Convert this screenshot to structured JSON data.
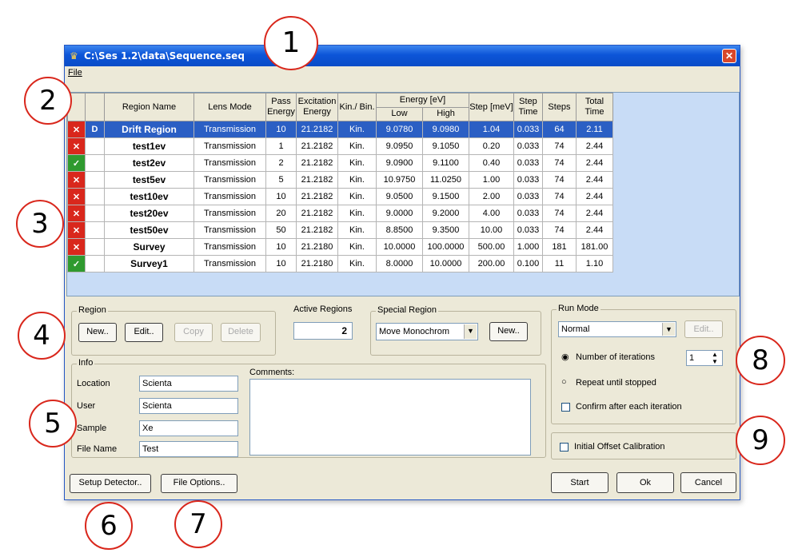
{
  "window": {
    "title": "C:\\Ses 1.2\\data\\Sequence.seq",
    "close_glyph": "✕"
  },
  "menu": {
    "file": "File"
  },
  "table": {
    "headers": {
      "region_name": "Region Name",
      "lens_mode": "Lens Mode",
      "pass_energy": "Pass Energy",
      "excitation_energy": "Excitation Energy",
      "kin_bin": "Kin./ Bin.",
      "energy_group": "Energy [eV]",
      "low": "Low",
      "high": "High",
      "step": "Step [meV]",
      "step_time": "Step Time",
      "steps": "Steps",
      "total_time": "Total Time"
    },
    "rows": [
      {
        "status": "x",
        "flag": "D",
        "name": "Drift Region",
        "lens": "Transmission",
        "pass": "10",
        "exc": "21.2182",
        "kin": "Kin.",
        "low": "9.0780",
        "high": "9.0980",
        "step": "1.04",
        "step_time": "0.033",
        "steps": "64",
        "total": "2.11",
        "selected": true
      },
      {
        "status": "x",
        "flag": "",
        "name": "test1ev",
        "lens": "Transmission",
        "pass": "1",
        "exc": "21.2182",
        "kin": "Kin.",
        "low": "9.0950",
        "high": "9.1050",
        "step": "0.20",
        "step_time": "0.033",
        "steps": "74",
        "total": "2.44"
      },
      {
        "status": "ok",
        "flag": "",
        "name": "test2ev",
        "lens": "Transmission",
        "pass": "2",
        "exc": "21.2182",
        "kin": "Kin.",
        "low": "9.0900",
        "high": "9.1100",
        "step": "0.40",
        "step_time": "0.033",
        "steps": "74",
        "total": "2.44"
      },
      {
        "status": "x",
        "flag": "",
        "name": "test5ev",
        "lens": "Transmission",
        "pass": "5",
        "exc": "21.2182",
        "kin": "Kin.",
        "low": "10.9750",
        "high": "11.0250",
        "step": "1.00",
        "step_time": "0.033",
        "steps": "74",
        "total": "2.44"
      },
      {
        "status": "x",
        "flag": "",
        "name": "test10ev",
        "lens": "Transmission",
        "pass": "10",
        "exc": "21.2182",
        "kin": "Kin.",
        "low": "9.0500",
        "high": "9.1500",
        "step": "2.00",
        "step_time": "0.033",
        "steps": "74",
        "total": "2.44"
      },
      {
        "status": "x",
        "flag": "",
        "name": "test20ev",
        "lens": "Transmission",
        "pass": "20",
        "exc": "21.2182",
        "kin": "Kin.",
        "low": "9.0000",
        "high": "9.2000",
        "step": "4.00",
        "step_time": "0.033",
        "steps": "74",
        "total": "2.44"
      },
      {
        "status": "x",
        "flag": "",
        "name": "test50ev",
        "lens": "Transmission",
        "pass": "50",
        "exc": "21.2182",
        "kin": "Kin.",
        "low": "8.8500",
        "high": "9.3500",
        "step": "10.00",
        "step_time": "0.033",
        "steps": "74",
        "total": "2.44"
      },
      {
        "status": "x",
        "flag": "",
        "name": "Survey",
        "lens": "Transmission",
        "pass": "10",
        "exc": "21.2180",
        "kin": "Kin.",
        "low": "10.0000",
        "high": "100.0000",
        "step": "500.00",
        "step_time": "1.000",
        "steps": "181",
        "total": "181.00"
      },
      {
        "status": "ok",
        "flag": "",
        "name": "Survey1",
        "lens": "Transmission",
        "pass": "10",
        "exc": "21.2180",
        "kin": "Kin.",
        "low": "8.0000",
        "high": "10.0000",
        "step": "200.00",
        "step_time": "0.100",
        "steps": "11",
        "total": "1.10"
      }
    ],
    "status_glyphs": {
      "x": "✕",
      "ok": "✓"
    }
  },
  "region": {
    "label": "Region",
    "new": "New..",
    "edit": "Edit..",
    "copy": "Copy",
    "delete": "Delete"
  },
  "active_regions": {
    "label": "Active Regions",
    "value": "2"
  },
  "special_region": {
    "label": "Special Region",
    "selected": "Move Monochrom",
    "new": "New.."
  },
  "run_mode": {
    "label": "Run Mode",
    "selected": "Normal",
    "edit": "Edit..",
    "iterations_label": "Number of iterations",
    "iterations_value": "1",
    "repeat_label": "Repeat until stopped",
    "confirm_label": "Confirm after each iteration"
  },
  "info": {
    "label": "Info",
    "location_label": "Location",
    "location_value": "Scienta",
    "user_label": "User",
    "user_value": "Scienta",
    "sample_label": "Sample",
    "sample_value": "Xe",
    "filename_label": "File Name",
    "filename_value": "Test",
    "comments_label": "Comments:"
  },
  "calibration": {
    "label": "Initial Offset Calibration"
  },
  "buttons": {
    "setup_detector": "Setup Detector..",
    "file_options": "File Options..",
    "start": "Start",
    "ok": "Ok",
    "cancel": "Cancel"
  },
  "callouts": {
    "c1": "1",
    "c2": "2",
    "c3": "3",
    "c4": "4",
    "c5": "5",
    "c6": "6",
    "c7": "7",
    "c8": "8",
    "c9": "9"
  },
  "colors": {
    "title_bar": "#0c55d8",
    "selection": "#2b5fc4",
    "error_status": "#d9271c",
    "ok_status": "#2f9a2f",
    "callout_ring": "#d9271c"
  }
}
